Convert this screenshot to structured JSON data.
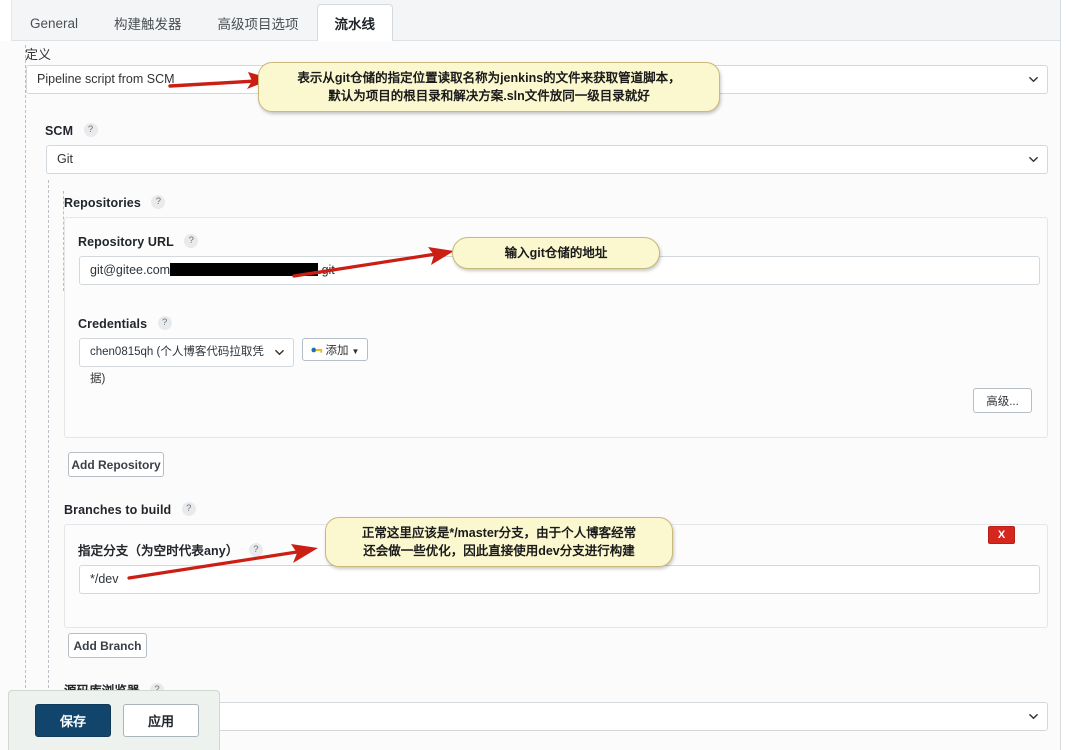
{
  "tabs": [
    {
      "label": "General",
      "active": false
    },
    {
      "label": "构建触发器",
      "active": false
    },
    {
      "label": "高级项目选项",
      "active": false
    },
    {
      "label": "流水线",
      "active": true
    }
  ],
  "definition": {
    "label": "定义",
    "value": "Pipeline script from SCM"
  },
  "scm": {
    "label": "SCM",
    "help": "?",
    "value": "Git"
  },
  "repositories": {
    "label": "Repositories",
    "help": "?",
    "url_label": "Repository URL",
    "url_help": "?",
    "url_prefix": "git@gitee.com",
    "url_suffix": ".git",
    "credentials_label": "Credentials",
    "credentials_help": "?",
    "credentials_value": "chen0815qh (个人博客代码拉取凭据)",
    "add_credential_label": "添加",
    "advanced_label": "高级...",
    "add_repository_label": "Add Repository"
  },
  "branches": {
    "label": "Branches to build",
    "help": "?",
    "specifier_label": "指定分支（为空时代表any）",
    "specifier_help": "?",
    "specifier_value": "*/dev",
    "delete_label": "X",
    "add_branch_label": "Add Branch"
  },
  "browser": {
    "label": "源码库浏览器",
    "help": "?",
    "value": ""
  },
  "savebar": {
    "save_label": "保存",
    "apply_label": "应用"
  },
  "callouts": [
    {
      "id": "definition-note",
      "line1": "表示从git仓储的指定位置读取名称为jenkins的文件来获取管道脚本，",
      "line2": "默认为项目的根目录和解决方案.sln文件放同一级目录就好"
    },
    {
      "id": "url-note",
      "line1": "输入git仓储的地址",
      "line2": ""
    },
    {
      "id": "branch-note",
      "line1": "正常这里应该是*/master分支，由于个人博客经常",
      "line2": "还会做一些优化，因此直接使用dev分支进行构建"
    }
  ],
  "colors": {
    "accent": "#12456b",
    "callout_bg": "#fbf8d0",
    "callout_border": "#c9b97a",
    "arrow": "#cc1f14",
    "danger": "#d6271f"
  }
}
